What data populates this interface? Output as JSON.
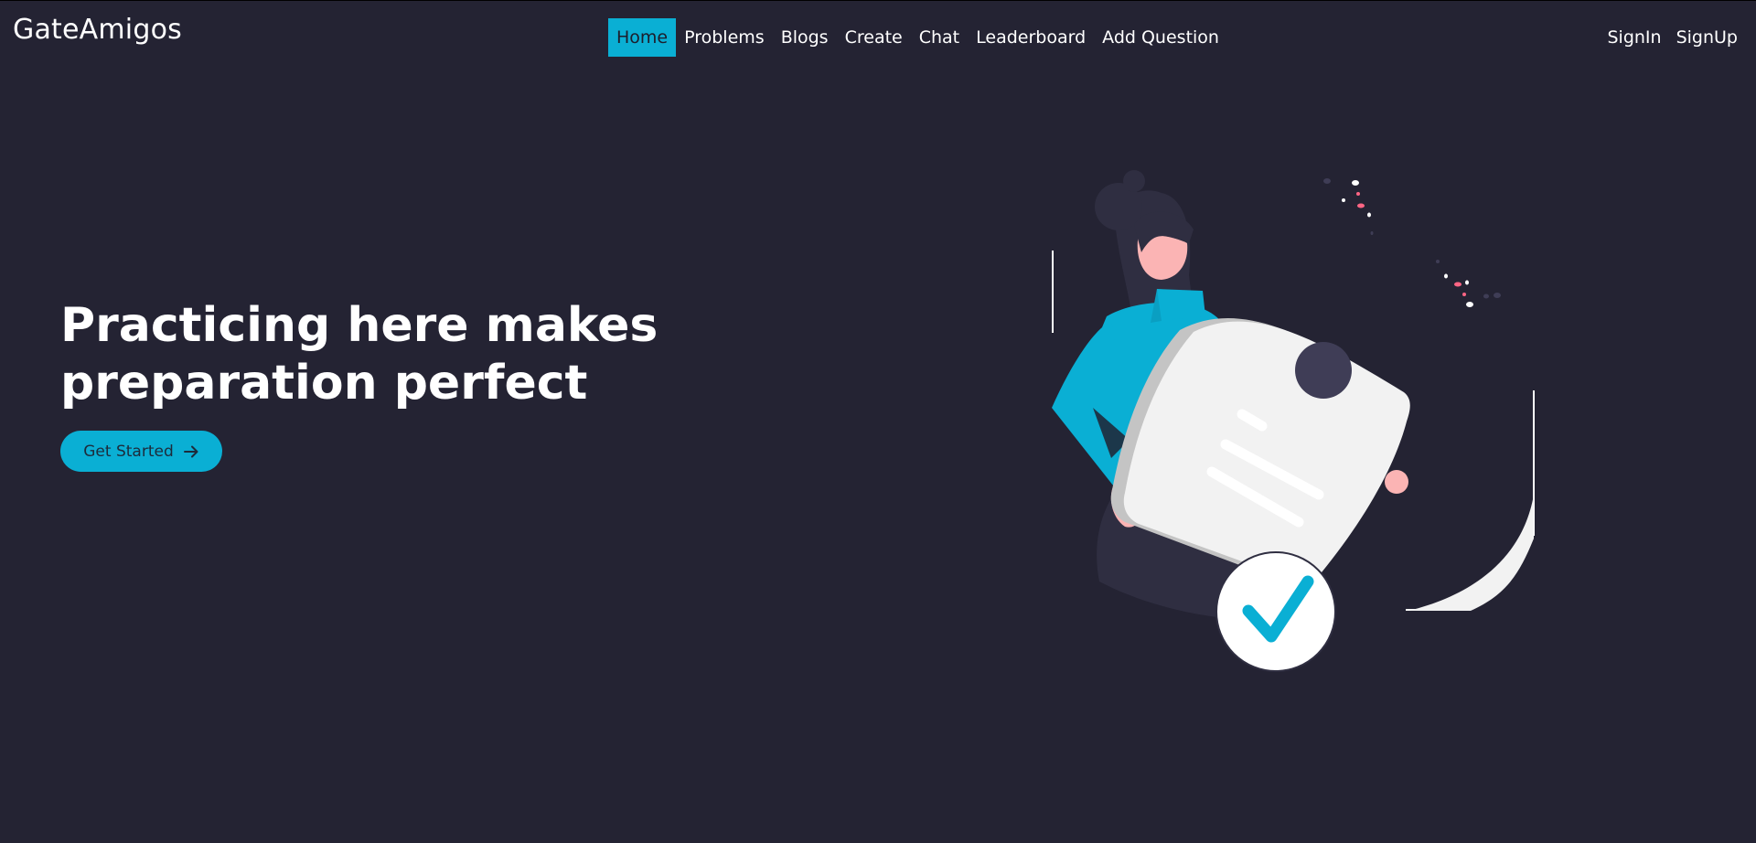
{
  "brand": {
    "name": "GateAmigos"
  },
  "nav": {
    "links": [
      {
        "label": "Home",
        "active": true
      },
      {
        "label": "Problems",
        "active": false
      },
      {
        "label": "Blogs",
        "active": false
      },
      {
        "label": "Create",
        "active": false
      },
      {
        "label": "Chat",
        "active": false
      },
      {
        "label": "Leaderboard",
        "active": false
      },
      {
        "label": "Add Question",
        "active": false
      }
    ],
    "auth": [
      {
        "label": "SignIn"
      },
      {
        "label": "SignUp"
      }
    ]
  },
  "hero": {
    "title_line1": "Practicing here makes",
    "title_line2": "preparation perfect",
    "cta_label": "Get Started",
    "cta_icon": "arrow-right-icon",
    "illustration": "person-holding-checklist-illustration"
  },
  "colors": {
    "background": "#242333",
    "accent": "#0aafd4",
    "text": "#ffffff",
    "skin": "#fbb4b4",
    "hair": "#2f2e41",
    "paper": "#f2f2f2",
    "paper_shadow": "#c4c4c4",
    "confetti_pink": "#ff6584"
  }
}
